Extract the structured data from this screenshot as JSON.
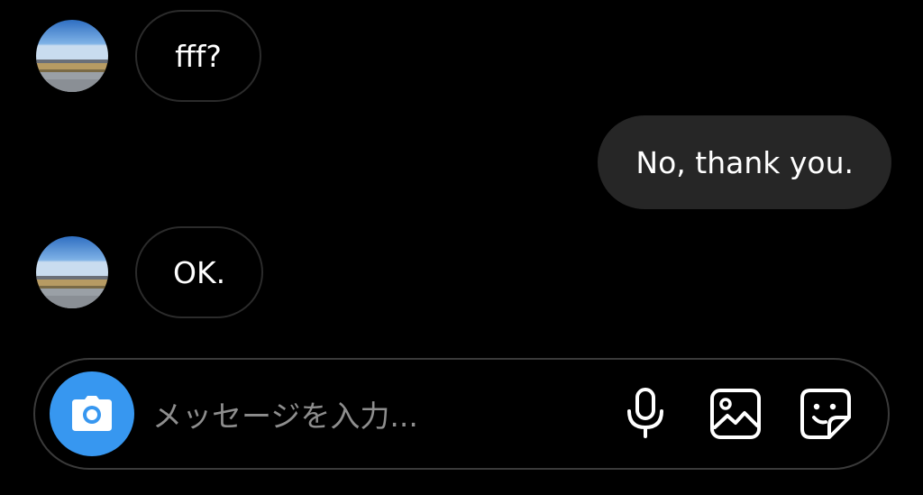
{
  "messages": [
    {
      "direction": "incoming",
      "text": "fff?"
    },
    {
      "direction": "outgoing",
      "text": "No, thank you."
    },
    {
      "direction": "incoming",
      "text": "OK."
    }
  ],
  "composer": {
    "placeholder": "メッセージを入力...",
    "icons": [
      "camera-icon",
      "microphone-icon",
      "gallery-icon",
      "sticker-icon"
    ],
    "camera_button_color": "#3797f0"
  },
  "colors": {
    "background": "#000000",
    "outgoing_bubble": "#262626",
    "incoming_bubble_border": "#2b2b2b",
    "text": "#ffffff",
    "placeholder": "#8e8e8e"
  }
}
